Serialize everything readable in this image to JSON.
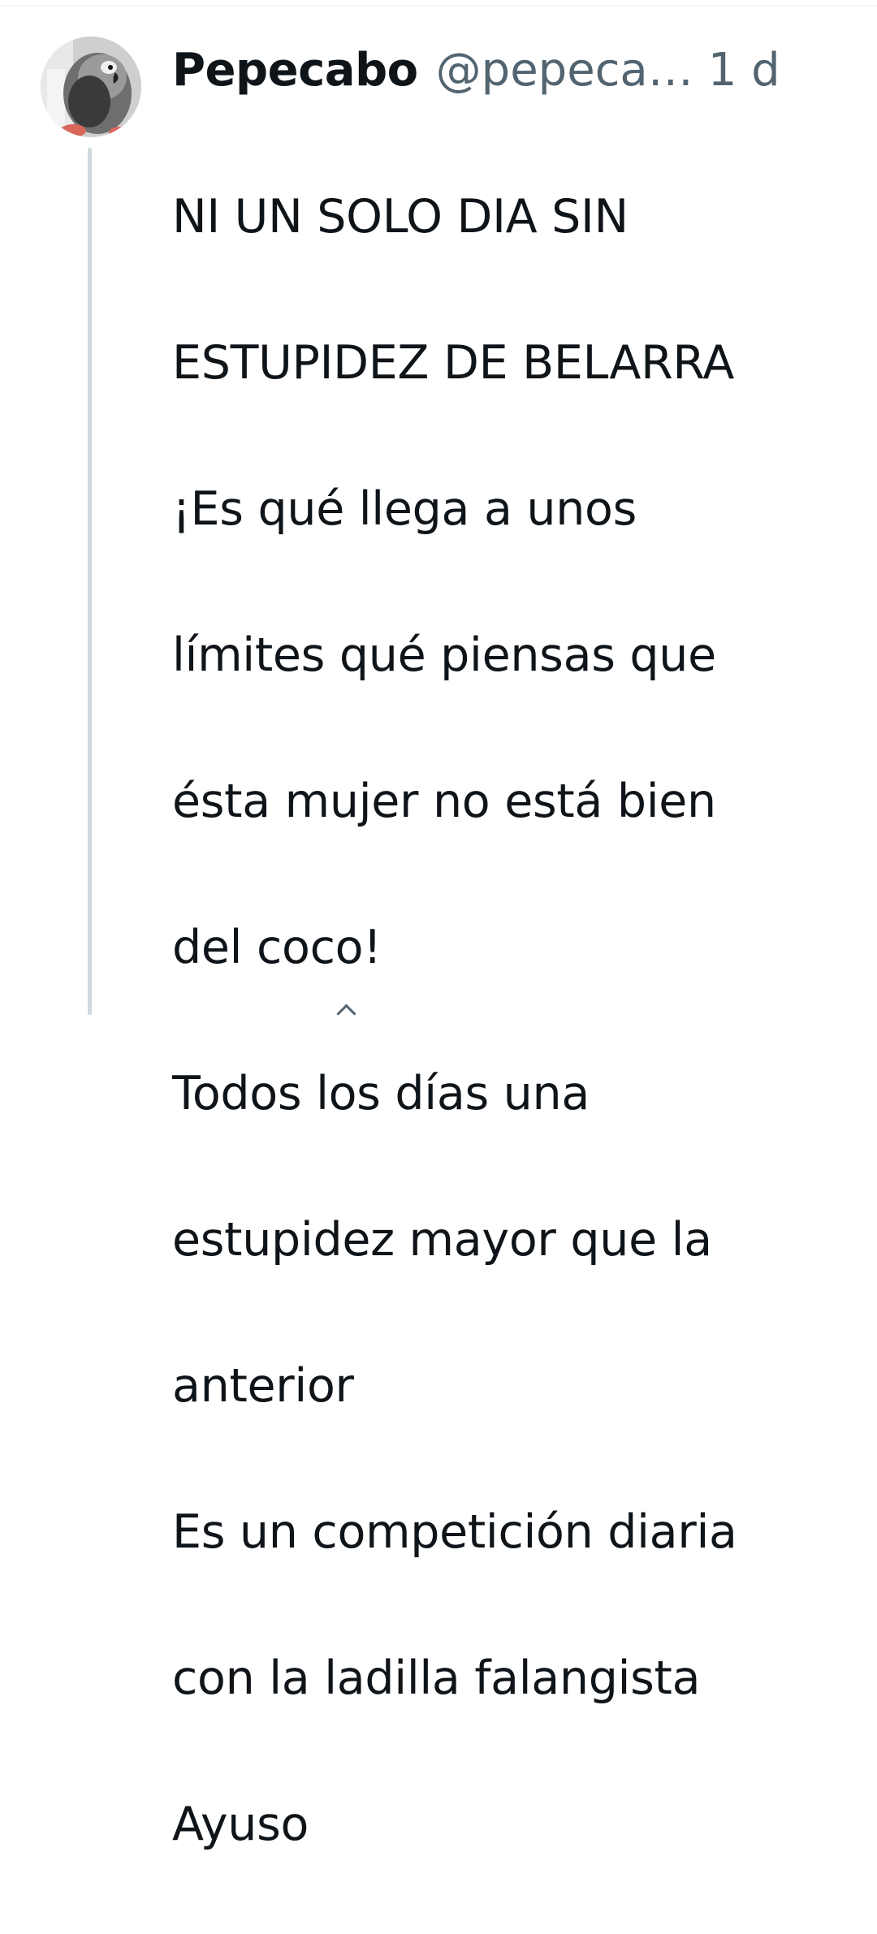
{
  "post": {
    "author": {
      "display_name": "Pepecabo",
      "handle": "@pepeca…",
      "avatar_icon": "parrot-avatar-icon"
    },
    "time": "1 d",
    "lines": [
      "NI UN SOLO DIA SIN",
      "ESTUPIDEZ DE BELARRA",
      "¡Es qué llega a unos",
      "límites qué piensas que",
      "ésta mujer no está bien",
      "del coco!",
      "Todos los días una",
      "estupidez mayor que la",
      "anterior",
      "Es un competición diaria",
      "con la ladilla falangista",
      "Ayuso"
    ]
  },
  "colors": {
    "text_primary": "#0f1419",
    "text_secondary": "#536471",
    "thread_line": "#cfd9de"
  }
}
